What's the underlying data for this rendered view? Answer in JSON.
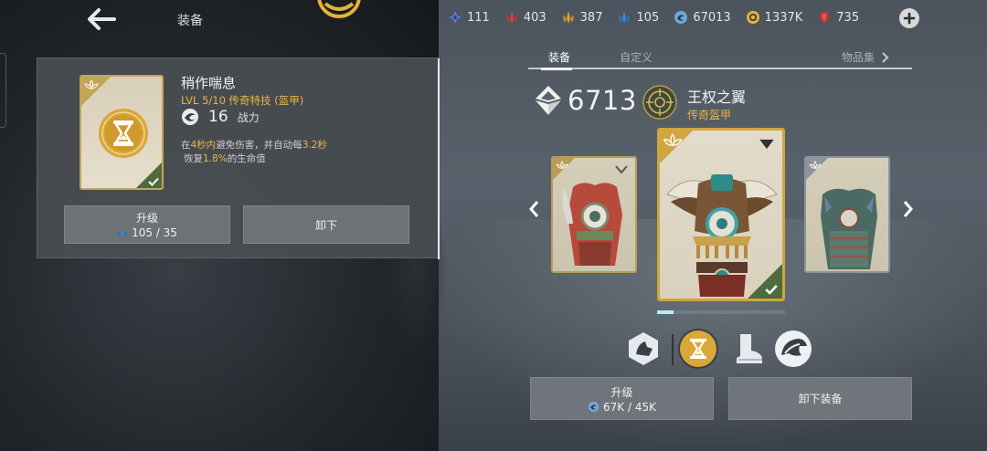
{
  "header": {
    "title": "装备",
    "currencies": [
      {
        "icon": "blue-star-shard-icon",
        "value": "111",
        "color": "#5a7fe0"
      },
      {
        "icon": "red-crystal-icon",
        "value": "403",
        "color": "#d0463c"
      },
      {
        "icon": "gold-crystal-icon",
        "value": "387",
        "color": "#d9a23a"
      },
      {
        "icon": "blue-crystal-icon",
        "value": "105",
        "color": "#3a88d6"
      },
      {
        "icon": "steel-swirl-icon",
        "value": "67013",
        "color": "#6fa7d9"
      },
      {
        "icon": "gold-coin-icon",
        "value": "1337K",
        "color": "#e0b23c"
      },
      {
        "icon": "red-shard-icon",
        "value": "735",
        "color": "#c43a33"
      }
    ]
  },
  "skill": {
    "name": "稍作喘息",
    "meta": "LVL  5/10  传奇特技 (盔甲)",
    "power_value": "16",
    "power_label": "战力",
    "desc_1a": "在",
    "desc_1b": "4秒内",
    "desc_1c": "避免伤害，并自动每",
    "desc_1d": "3.2秒",
    "desc_2a": "恢复",
    "desc_2b": "1.8%",
    "desc_2c": "的生命值",
    "upgrade_label": "升级",
    "upgrade_cost": "105 / 35",
    "unequip_label": "卸下"
  },
  "tabs": {
    "equip": "装备",
    "custom": "自定义",
    "collection": "物品集"
  },
  "item": {
    "power": "6713",
    "name": "王权之翼",
    "rarity": "传奇盔甲",
    "progress": 0.13
  },
  "actions": {
    "upgrade_label": "升级",
    "upgrade_cost": "67K / 45K",
    "unequip_label": "卸下装备"
  },
  "colors": {
    "legendary_gold": "#e6b743",
    "equipped_green": "#4d6b3c"
  }
}
